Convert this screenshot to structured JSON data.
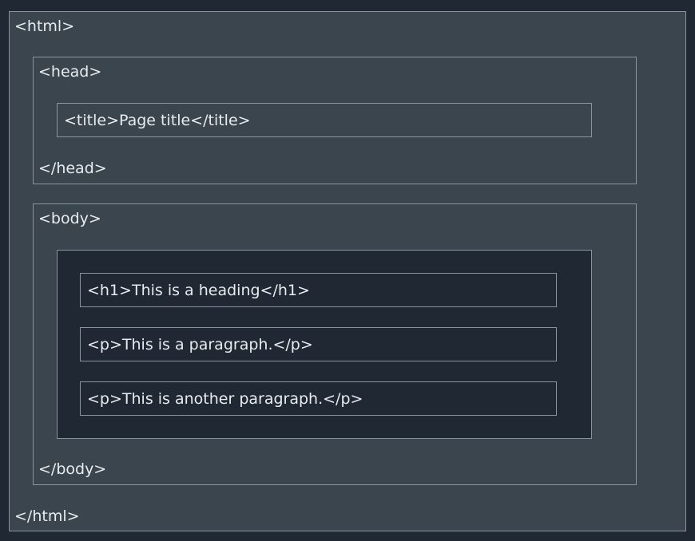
{
  "html_block": {
    "open": "<html>",
    "close": "</html>"
  },
  "head_block": {
    "open": "<head>",
    "close": "</head>",
    "title_line": "<title>Page title</title>"
  },
  "body_block": {
    "open": "<body>",
    "close": "</body>",
    "lines": [
      "<h1>This is a heading</h1>",
      "<p>This is a paragraph.</p>",
      "<p>This is another paragraph.</p>"
    ]
  },
  "colors": {
    "page_background": "#1f2833",
    "block_background": "#3a454e",
    "border": "#8a949c",
    "text": "#e8ecef"
  }
}
